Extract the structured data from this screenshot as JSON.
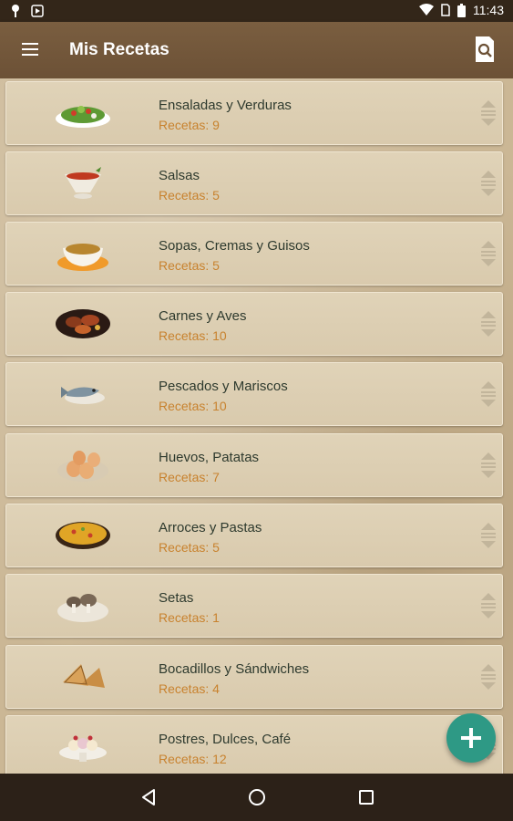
{
  "status_bar": {
    "time": "11:43",
    "left_icons": [
      "pin-notification-icon",
      "play-store-notification-icon"
    ],
    "right_icons": [
      "wifi-icon",
      "sim-card-icon",
      "battery-icon"
    ]
  },
  "app_bar": {
    "title": "Mis Recetas",
    "menu_icon": "menu-icon",
    "search_icon": "search-icon"
  },
  "categories": [
    {
      "name": "Ensaladas y Verduras",
      "count_label": "Recetas: 9",
      "icon": "salad-icon"
    },
    {
      "name": "Salsas",
      "count_label": "Recetas: 5",
      "icon": "sauce-icon"
    },
    {
      "name": "Sopas, Cremas y Guisos",
      "count_label": "Recetas: 5",
      "icon": "soup-icon"
    },
    {
      "name": "Carnes y Aves",
      "count_label": "Recetas: 10",
      "icon": "meat-icon"
    },
    {
      "name": "Pescados y Mariscos",
      "count_label": "Recetas: 10",
      "icon": "fish-icon"
    },
    {
      "name": "Huevos, Patatas",
      "count_label": "Recetas: 7",
      "icon": "eggs-icon"
    },
    {
      "name": "Arroces y Pastas",
      "count_label": "Recetas: 5",
      "icon": "rice-icon"
    },
    {
      "name": "Setas",
      "count_label": "Recetas: 1",
      "icon": "mushroom-icon"
    },
    {
      "name": "Bocadillos y Sándwiches",
      "count_label": "Recetas: 4",
      "icon": "sandwich-icon"
    },
    {
      "name": "Postres, Dulces, Café",
      "count_label": "Recetas: 12",
      "icon": "dessert-icon"
    }
  ],
  "fab": {
    "icon": "add-icon"
  },
  "nav_bar": {
    "icons": [
      "back-icon",
      "home-icon",
      "recents-icon"
    ]
  },
  "colors": {
    "app_bar": "#6c5136",
    "count_text": "#c8822e",
    "name_text": "#2e3a2e",
    "fab": "#2e9985",
    "card": "#dccfb2"
  }
}
